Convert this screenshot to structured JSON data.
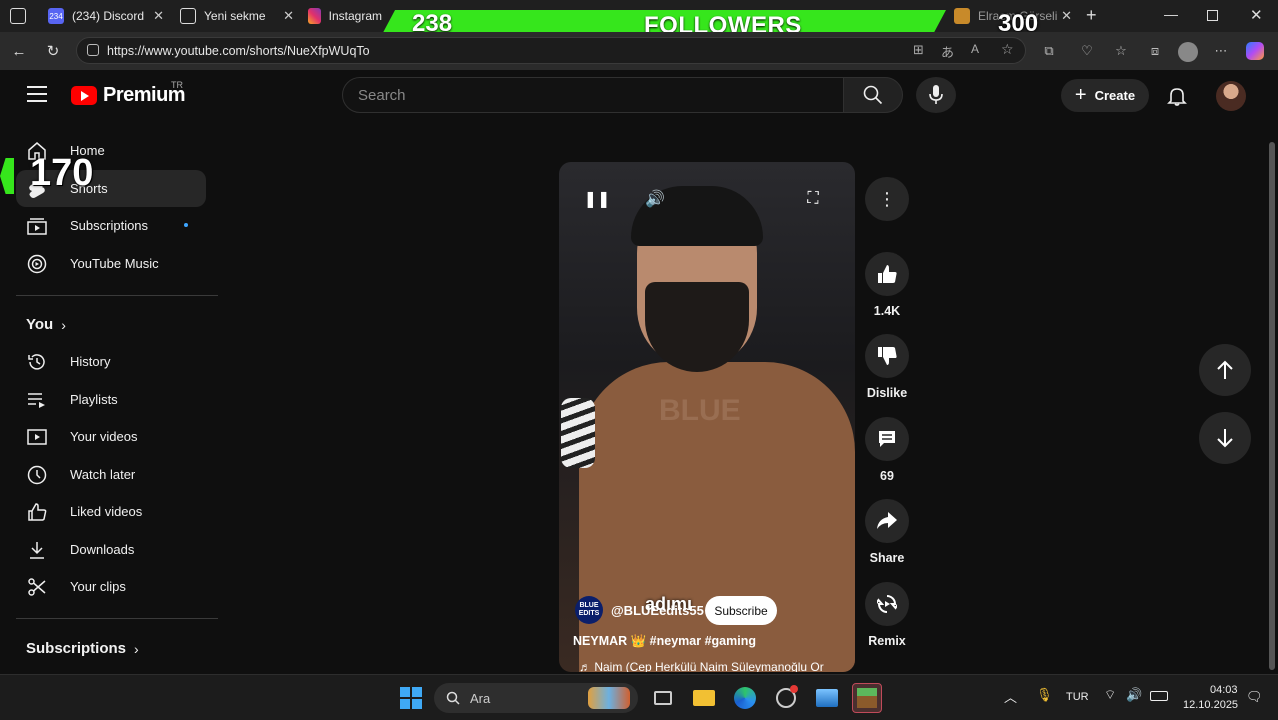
{
  "browser": {
    "tabs": [
      {
        "title": "(234) Discord",
        "icon": "discord-icon",
        "badge": "234"
      },
      {
        "title": "Yeni sekme",
        "icon": "newtab-icon"
      },
      {
        "title": "Instagram",
        "icon": "instagram-icon"
      },
      {
        "title": "Elraem Görseli",
        "icon": "image-icon"
      }
    ],
    "url": "https://www.youtube.com/shorts/NueXfpWUqTo"
  },
  "overlay": {
    "followers_count": "238",
    "followers_label": "FOLLOWERS",
    "followers_goal": "300",
    "side_counter": "170"
  },
  "header": {
    "logo_text": "Premium",
    "logo_region": "TR",
    "search_placeholder": "Search",
    "create_label": "Create"
  },
  "sidebar": {
    "items_top": [
      {
        "label": "Home",
        "icon": "home-icon"
      },
      {
        "label": "Shorts",
        "icon": "shorts-icon"
      },
      {
        "label": "Subscriptions",
        "icon": "subscriptions-icon"
      },
      {
        "label": "YouTube Music",
        "icon": "music-icon"
      }
    ],
    "you_heading": "You",
    "items_you": [
      {
        "label": "History",
        "icon": "history-icon"
      },
      {
        "label": "Playlists",
        "icon": "playlists-icon"
      },
      {
        "label": "Your videos",
        "icon": "your-videos-icon"
      },
      {
        "label": "Watch later",
        "icon": "watch-later-icon"
      },
      {
        "label": "Liked videos",
        "icon": "liked-icon"
      },
      {
        "label": "Downloads",
        "icon": "download-icon"
      },
      {
        "label": "Your clips",
        "icon": "clips-icon"
      }
    ],
    "subscriptions_heading": "Subscriptions"
  },
  "short": {
    "caption": "adımı",
    "shirt_text": "BLUE",
    "channel_avatar_text": "BLUE EDITS",
    "channel_name": "@BLUEedits55",
    "subscribe_label": "Subscribe",
    "title": "NEYMAR 👑 #neymar #gaming",
    "sound": "♬ Naim (Cep Herkülü Naim Süleymanoğlu Or"
  },
  "actions": {
    "likes": "1.4K",
    "dislike": "Dislike",
    "comments": "69",
    "share": "Share",
    "remix": "Remix"
  },
  "taskbar": {
    "search_text": "Ara",
    "language": "TUR",
    "time": "04:03",
    "date": "12.10.2025"
  },
  "colors": {
    "youtube_red": "#ff0000",
    "overlay_green": "#36e61c",
    "background": "#0f0f0f"
  }
}
